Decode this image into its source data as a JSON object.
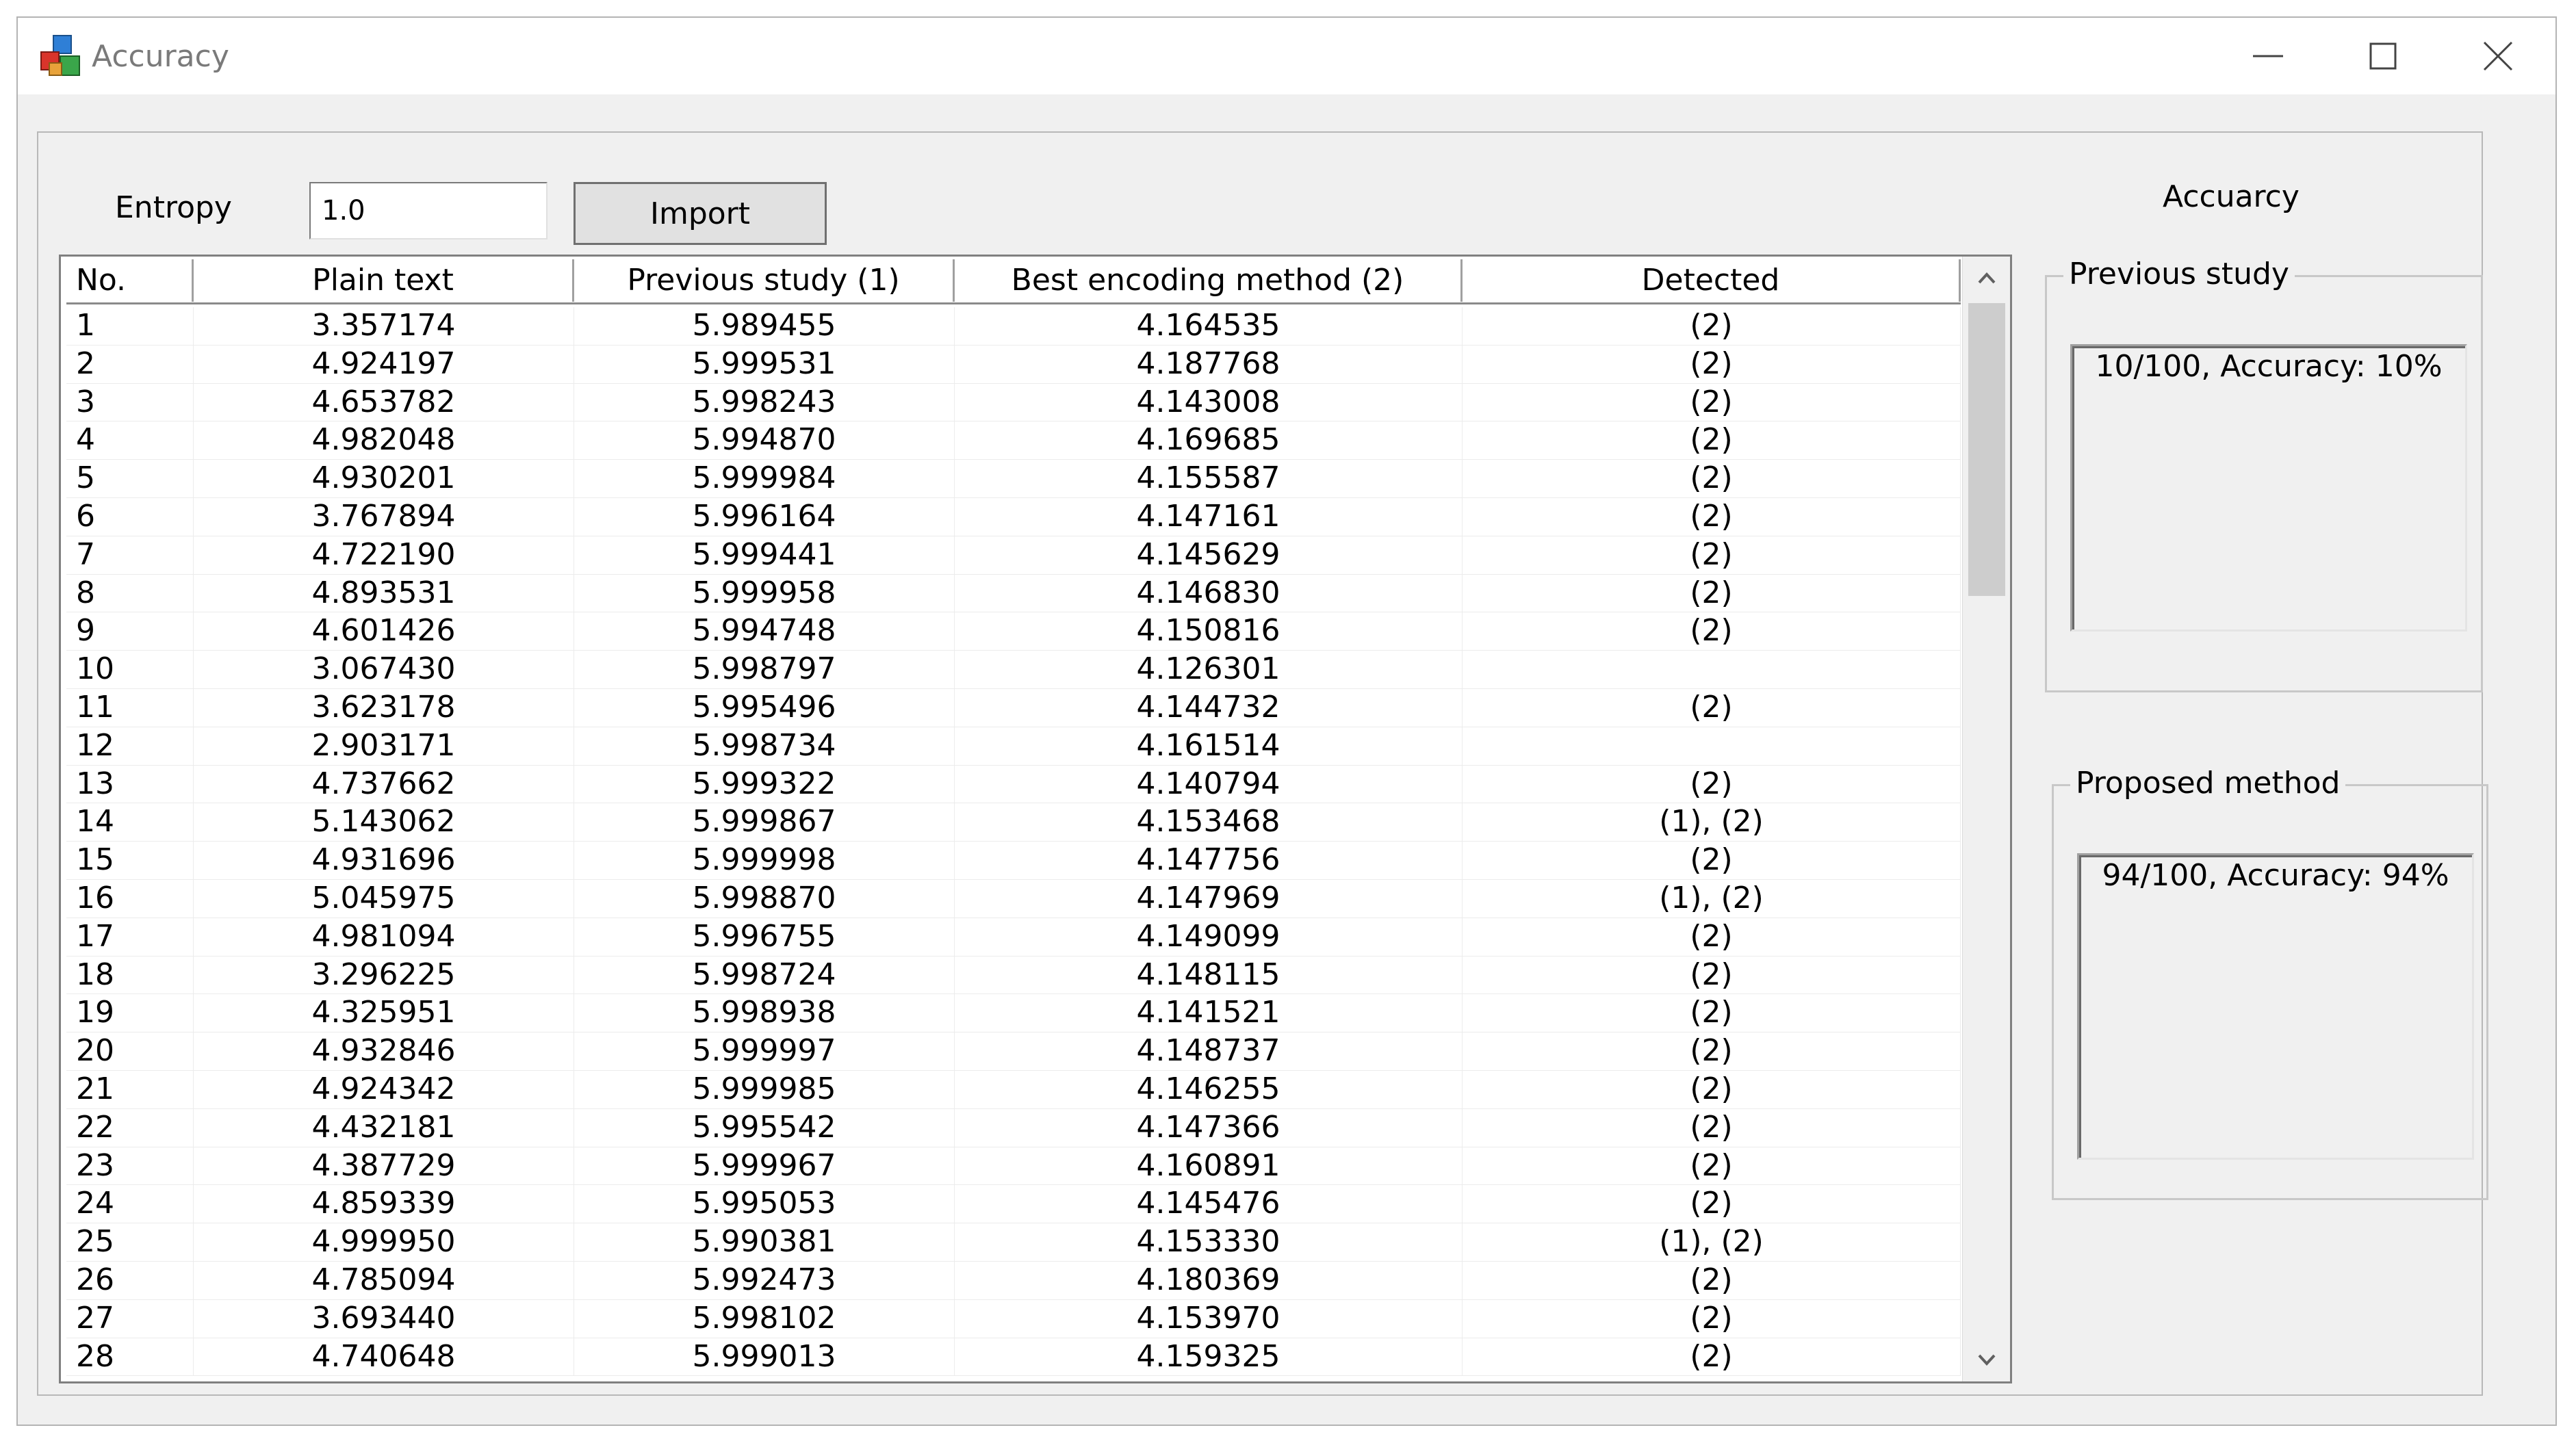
{
  "window": {
    "title": "Accuracy",
    "icon": "colored-cubes-app-icon",
    "controls": [
      "minimize-icon",
      "maximize-icon",
      "close-icon"
    ]
  },
  "toolbar": {
    "entropy_label": "Entropy",
    "entropy_value": "1.0",
    "import_label": "Import"
  },
  "accuracy_panel": {
    "heading": "Accuarcy",
    "previous": {
      "title": "Previous study",
      "result": "10/100, Accuracy: 10%"
    },
    "proposed": {
      "title": "Proposed method",
      "result": "94/100, Accuracy: 94%"
    }
  },
  "table": {
    "columns": [
      "No.",
      "Plain text",
      "Previous study (1)",
      "Best encoding method (2)",
      "Detected"
    ],
    "rows": [
      [
        "1",
        "3.357174",
        "5.989455",
        "4.164535",
        "(2)"
      ],
      [
        "2",
        "4.924197",
        "5.999531",
        "4.187768",
        "(2)"
      ],
      [
        "3",
        "4.653782",
        "5.998243",
        "4.143008",
        "(2)"
      ],
      [
        "4",
        "4.982048",
        "5.994870",
        "4.169685",
        "(2)"
      ],
      [
        "5",
        "4.930201",
        "5.999984",
        "4.155587",
        "(2)"
      ],
      [
        "6",
        "3.767894",
        "5.996164",
        "4.147161",
        "(2)"
      ],
      [
        "7",
        "4.722190",
        "5.999441",
        "4.145629",
        "(2)"
      ],
      [
        "8",
        "4.893531",
        "5.999958",
        "4.146830",
        "(2)"
      ],
      [
        "9",
        "4.601426",
        "5.994748",
        "4.150816",
        "(2)"
      ],
      [
        "10",
        "3.067430",
        "5.998797",
        "4.126301",
        ""
      ],
      [
        "11",
        "3.623178",
        "5.995496",
        "4.144732",
        "(2)"
      ],
      [
        "12",
        "2.903171",
        "5.998734",
        "4.161514",
        ""
      ],
      [
        "13",
        "4.737662",
        "5.999322",
        "4.140794",
        "(2)"
      ],
      [
        "14",
        "5.143062",
        "5.999867",
        "4.153468",
        "(1), (2)"
      ],
      [
        "15",
        "4.931696",
        "5.999998",
        "4.147756",
        "(2)"
      ],
      [
        "16",
        "5.045975",
        "5.998870",
        "4.147969",
        "(1), (2)"
      ],
      [
        "17",
        "4.981094",
        "5.996755",
        "4.149099",
        "(2)"
      ],
      [
        "18",
        "3.296225",
        "5.998724",
        "4.148115",
        "(2)"
      ],
      [
        "19",
        "4.325951",
        "5.998938",
        "4.141521",
        "(2)"
      ],
      [
        "20",
        "4.932846",
        "5.999997",
        "4.148737",
        "(2)"
      ],
      [
        "21",
        "4.924342",
        "5.999985",
        "4.146255",
        "(2)"
      ],
      [
        "22",
        "4.432181",
        "5.995542",
        "4.147366",
        "(2)"
      ],
      [
        "23",
        "4.387729",
        "5.999967",
        "4.160891",
        "(2)"
      ],
      [
        "24",
        "4.859339",
        "5.995053",
        "4.145476",
        "(2)"
      ],
      [
        "25",
        "4.999950",
        "5.990381",
        "4.153330",
        "(1), (2)"
      ],
      [
        "26",
        "4.785094",
        "5.992473",
        "4.180369",
        "(2)"
      ],
      [
        "27",
        "3.693440",
        "5.998102",
        "4.153970",
        "(2)"
      ],
      [
        "28",
        "4.740648",
        "5.999013",
        "4.159325",
        "(2)"
      ]
    ],
    "scroll_icons": [
      "scroll-up-icon",
      "scroll-down-icon"
    ]
  }
}
